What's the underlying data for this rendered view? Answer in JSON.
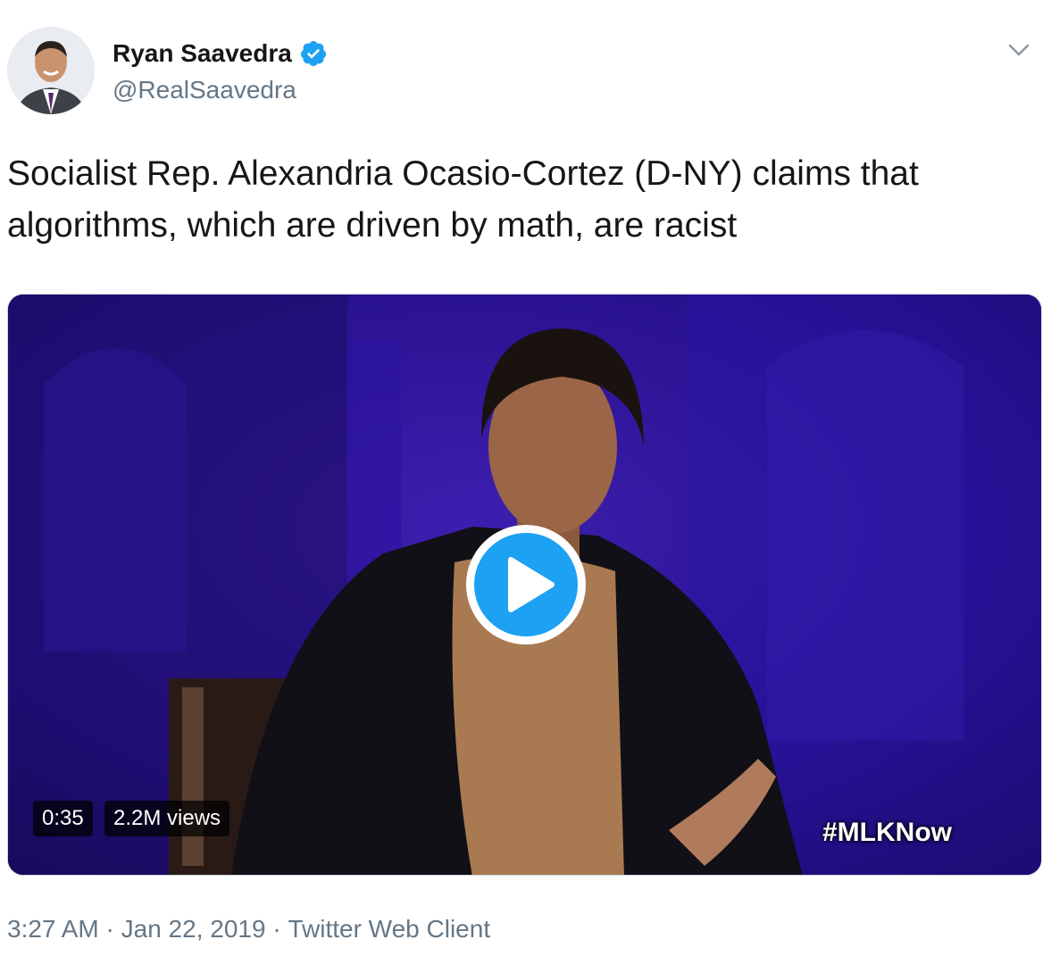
{
  "author": {
    "display_name": "Ryan Saavedra",
    "handle": "@RealSaavedra",
    "verified": true
  },
  "tweet": {
    "text": "Socialist Rep. Alexandria Ocasio-Cortez (D-NY) claims that algorithms, which are driven by math, are racist"
  },
  "media": {
    "type": "video",
    "duration": "0:35",
    "views": "2.2M views",
    "overlay_hashtag": "#MLKNow"
  },
  "footer": {
    "time": "3:27 AM",
    "date": "Jan 22, 2019",
    "source": "Twitter Web Client",
    "separator": " · "
  },
  "icons": {
    "verified": "verified-badge-icon",
    "caret": "chevron-down-icon",
    "play": "play-icon"
  },
  "colors": {
    "accent": "#1da1f2",
    "secondary_text": "#657786",
    "primary_text": "#14171a"
  }
}
